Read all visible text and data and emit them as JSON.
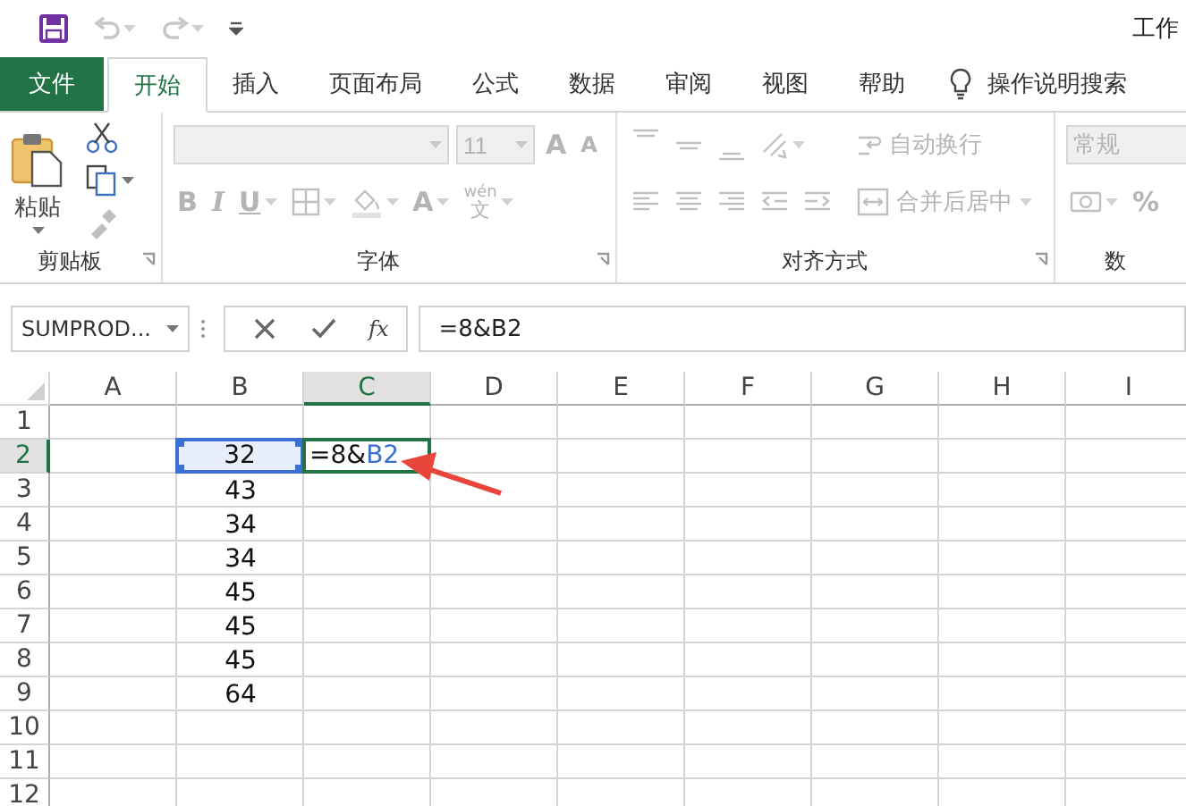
{
  "title_bar": {
    "title": "工作",
    "quick_access": [
      {
        "kind": "save",
        "dropdown": false,
        "disabled": false
      },
      {
        "kind": "undo",
        "dropdown": true,
        "disabled": true
      },
      {
        "kind": "redo",
        "dropdown": true,
        "disabled": true
      },
      {
        "kind": "customize",
        "dropdown": false,
        "disabled": false
      }
    ]
  },
  "tabs": [
    {
      "label": "文件",
      "kind": "file",
      "selected": false
    },
    {
      "label": "开始",
      "kind": "tab",
      "selected": true
    },
    {
      "label": "插入",
      "kind": "tab",
      "selected": false
    },
    {
      "label": "页面布局",
      "kind": "tab",
      "selected": false
    },
    {
      "label": "公式",
      "kind": "tab",
      "selected": false
    },
    {
      "label": "数据",
      "kind": "tab",
      "selected": false
    },
    {
      "label": "审阅",
      "kind": "tab",
      "selected": false
    },
    {
      "label": "视图",
      "kind": "tab",
      "selected": false
    },
    {
      "label": "帮助",
      "kind": "tab",
      "selected": false
    },
    {
      "label": "操作说明搜索",
      "kind": "search",
      "selected": false
    }
  ],
  "ribbon": {
    "groups": [
      {
        "label": "剪贴板",
        "launcher": true,
        "columns": [
          [
            [
              {
                "kind": "paste",
                "label": "粘贴",
                "dropdown": true,
                "disabled": false
              }
            ]
          ],
          [
            [
              {
                "kind": "cut",
                "dropdown": false,
                "disabled": false
              }
            ],
            [
              {
                "kind": "copy",
                "dropdown": true,
                "disabled": false
              }
            ],
            [
              {
                "kind": "format-painter",
                "dropdown": false,
                "disabled": true
              }
            ]
          ]
        ]
      },
      {
        "label": "字体",
        "launcher": true,
        "columns": [
          [
            [
              {
                "kind": "font-name",
                "dropdown": true,
                "disabled": true
              },
              {
                "kind": "font-size",
                "value": "11",
                "dropdown": true,
                "disabled": true
              },
              {
                "kind": "grow-font",
                "label": "A",
                "dropdown": false,
                "disabled": true
              },
              {
                "kind": "shrink-font",
                "label": "A",
                "dropdown": false,
                "disabled": true
              }
            ],
            [
              {
                "kind": "bold",
                "label": "B",
                "dropdown": false,
                "disabled": true
              },
              {
                "kind": "italic",
                "label": "I",
                "dropdown": false,
                "disabled": true
              },
              {
                "kind": "underline",
                "label": "U",
                "dropdown": true,
                "disabled": true
              },
              {
                "kind": "borders",
                "dropdown": true,
                "disabled": true
              },
              {
                "kind": "fill-color",
                "dropdown": true,
                "disabled": true
              },
              {
                "kind": "font-color",
                "label": "A",
                "dropdown": true,
                "disabled": true
              },
              {
                "kind": "phonetic",
                "label": "wén",
                "sublabel": "文",
                "dropdown": true,
                "disabled": true
              }
            ]
          ]
        ]
      },
      {
        "label": "对齐方式",
        "launcher": true,
        "columns": [
          [
            [
              {
                "kind": "align-top",
                "dropdown": false,
                "disabled": true
              },
              {
                "kind": "align-middle",
                "dropdown": false,
                "disabled": true
              },
              {
                "kind": "align-bottom",
                "dropdown": false,
                "disabled": true
              },
              {
                "kind": "orientation",
                "dropdown": true,
                "disabled": true
              }
            ],
            [
              {
                "kind": "align-left",
                "dropdown": false,
                "disabled": true
              },
              {
                "kind": "align-center",
                "dropdown": false,
                "disabled": true
              },
              {
                "kind": "align-right",
                "dropdown": false,
                "disabled": true
              },
              {
                "kind": "outdent",
                "dropdown": false,
                "disabled": true
              },
              {
                "kind": "indent",
                "dropdown": false,
                "disabled": true
              }
            ]
          ],
          [
            [
              {
                "kind": "wrap-text",
                "label": "自动换行",
                "dropdown": false,
                "disabled": true
              }
            ],
            [
              {
                "kind": "merge-center",
                "label": "合并后居中",
                "dropdown": true,
                "disabled": true
              }
            ]
          ]
        ]
      },
      {
        "label": "数",
        "launcher": false,
        "columns": [
          [
            [
              {
                "kind": "number-format",
                "value": "常规",
                "disabled": true
              }
            ],
            [
              {
                "kind": "currency",
                "dropdown": true,
                "disabled": true
              },
              {
                "kind": "percent",
                "label": "%",
                "dropdown": false,
                "disabled": true
              }
            ]
          ]
        ]
      }
    ]
  },
  "formula_bar": {
    "name_box": "SUMPROD...",
    "function_label": "fx",
    "formula": "=8&B2"
  },
  "sheet": {
    "columns": [
      {
        "label": "A",
        "selected": false
      },
      {
        "label": "B",
        "selected": false
      },
      {
        "label": "C",
        "selected": true
      },
      {
        "label": "D",
        "selected": false
      },
      {
        "label": "E",
        "selected": false
      },
      {
        "label": "F",
        "selected": false
      },
      {
        "label": "G",
        "selected": false
      },
      {
        "label": "H",
        "selected": false
      },
      {
        "label": "I",
        "selected": false
      }
    ],
    "rows": [
      {
        "label": "1",
        "selected": false
      },
      {
        "label": "2",
        "selected": true,
        "cells": [
          null,
          {
            "value": "32",
            "reference_highlight": true
          },
          {
            "parts": [
              {
                "text": "=8&",
                "kind": "plain"
              },
              {
                "text": "B2",
                "kind": "reference"
              }
            ],
            "active": true
          }
        ]
      },
      {
        "label": "3",
        "selected": false,
        "cells": [
          null,
          {
            "value": "43"
          }
        ]
      },
      {
        "label": "4",
        "selected": false,
        "cells": [
          null,
          {
            "value": "34"
          }
        ]
      },
      {
        "label": "5",
        "selected": false,
        "cells": [
          null,
          {
            "value": "34"
          }
        ]
      },
      {
        "label": "6",
        "selected": false,
        "cells": [
          null,
          {
            "value": "45"
          }
        ]
      },
      {
        "label": "7",
        "selected": false,
        "cells": [
          null,
          {
            "value": "45"
          }
        ]
      },
      {
        "label": "8",
        "selected": false,
        "cells": [
          null,
          {
            "value": "45"
          }
        ]
      },
      {
        "label": "9",
        "selected": false,
        "cells": [
          null,
          {
            "value": "64"
          }
        ]
      },
      {
        "label": "10",
        "selected": false
      },
      {
        "label": "11",
        "selected": false
      },
      {
        "label": "12",
        "selected": false
      }
    ]
  },
  "annotation": {
    "kind": "arrow"
  }
}
